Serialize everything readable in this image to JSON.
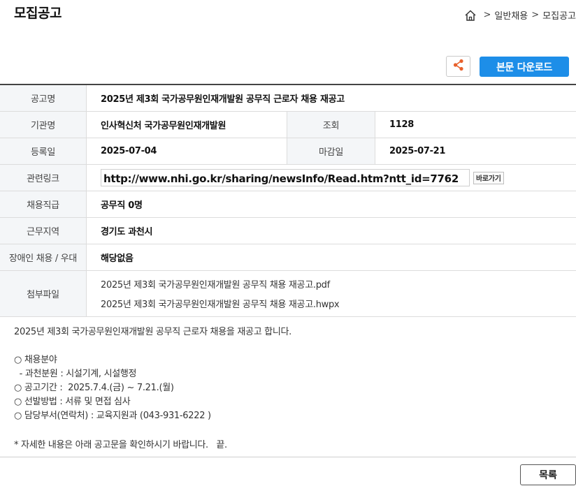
{
  "page": {
    "title": "모집공고"
  },
  "breadcrumb": {
    "sep1": ">",
    "item1": "일반채용",
    "sep2": ">",
    "item2": "모집공고"
  },
  "toolbar": {
    "download_label": "본문 다운로드"
  },
  "info": {
    "title_label": "공고명",
    "title_value": "2025년 제3회 국가공무원인재개발원 공무직 근로자 채용 재공고",
    "org_label": "기관명",
    "org_value": "인사혁신처 국가공무원인재개발원",
    "views_label": "조회",
    "views_value": "1128",
    "reg_label": "등록일",
    "reg_value": "2025-07-04",
    "deadline_label": "마감일",
    "deadline_value": "2025-07-21",
    "link_label": "관련링크",
    "link_value": "http://www.nhi.go.kr/sharing/newsInfo/Read.htm?ntt_id=7762",
    "goto_label": "바로가기",
    "job_label": "채용직급",
    "job_value": "공무직 0명",
    "region_label": "근무지역",
    "region_value": "경기도 과천시",
    "disabled_label": "장애인 채용 / 우대",
    "disabled_value": "해당없음",
    "files_label": "첨부파일",
    "files": [
      "2025년 제3회 국가공무원인재개발원 공무직 채용 재공고.pdf",
      "2025년 제3회 국가공무원인재개발원 공무직 채용 재공고.hwpx"
    ]
  },
  "content": {
    "intro": "2025년 제3회 국가공무원인재개발원 공무직 근로자 채용을 재공고 합니다.",
    "field": "○ 채용분야",
    "field_detail": "  - 과천분원 : 시설기계, 시설행정",
    "period": "○ 공고기간 :  2025.7.4.(금) ~ 7.21.(월)",
    "method": "○ 선발방법 : 서류 및 면접 심사",
    "contact": "○ 담당부서(연락처) : 교육지원과 (043-931-6222 )",
    "note": "* 자세한 내용은 아래 공고문을 확인하시기 바랍니다.   끝."
  },
  "footer": {
    "list_label": "목록"
  },
  "colors": {
    "accent": "#1d8ee8",
    "share_icon": "#e8612c",
    "header_bg": "#f4f6f8"
  },
  "icons": {
    "home": "home-icon",
    "share": "share-icon"
  }
}
